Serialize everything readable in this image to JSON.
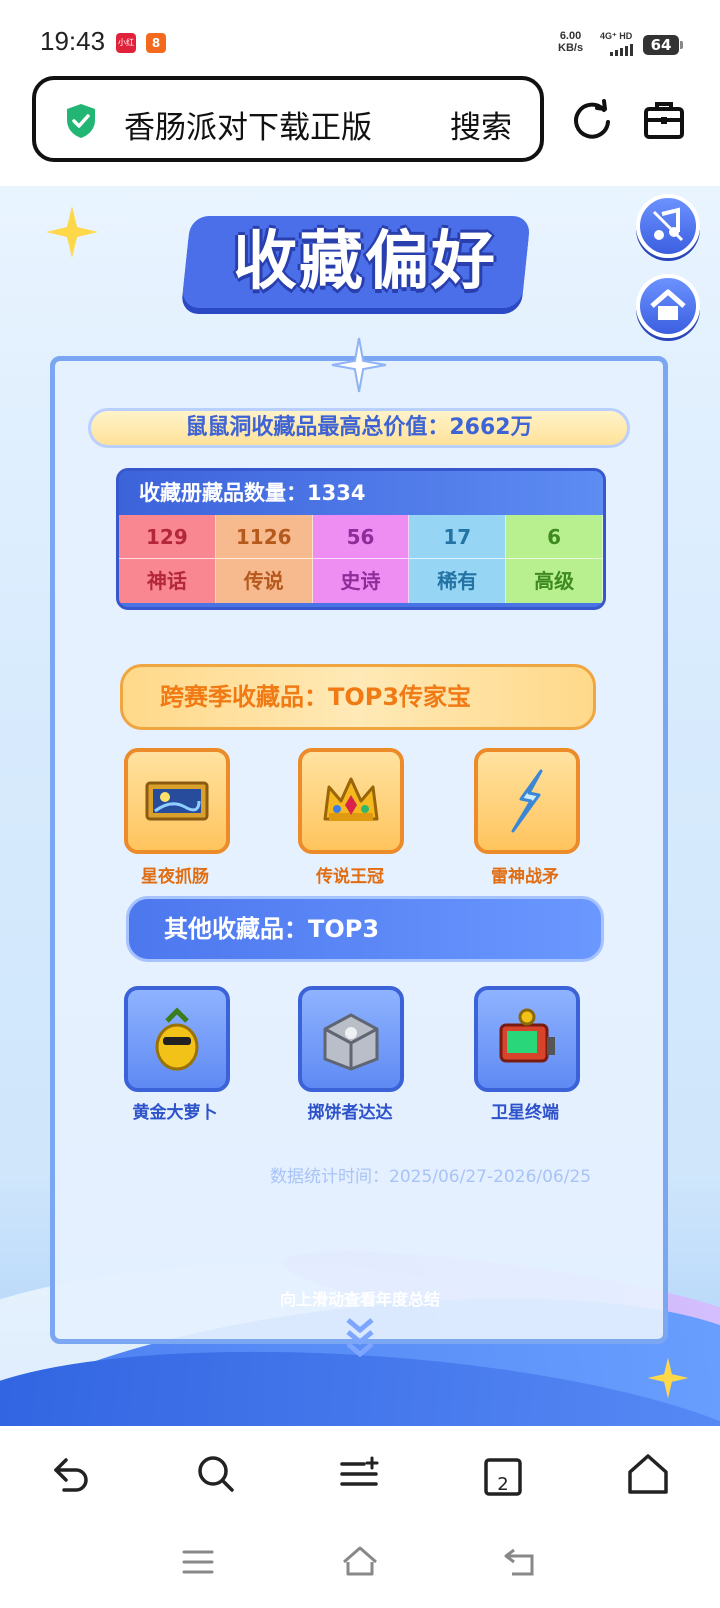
{
  "status_bar": {
    "time": "19:43",
    "app_badge_1": "小红书",
    "app_badge_2": "8",
    "net_speed": "6.00",
    "net_speed_unit": "KB/s",
    "network": "4G⁺ HD",
    "battery": "64"
  },
  "browser": {
    "search_text": "香肠派对下载正版",
    "search_button": "搜索",
    "refresh_icon": "refresh-icon",
    "toolbox_icon": "toolbox-icon",
    "shield_color": "#22b573"
  },
  "page": {
    "title": "收藏偏好",
    "max_value_label": "鼠鼠洞收藏品最高总价值：2662万",
    "collection_count_label": "收藏册藏品数量：",
    "collection_count": "1334",
    "tiers": [
      {
        "count": "129",
        "name": "神话"
      },
      {
        "count": "1126",
        "name": "传说"
      },
      {
        "count": "56",
        "name": "史诗"
      },
      {
        "count": "17",
        "name": "稀有"
      },
      {
        "count": "6",
        "name": "高级"
      }
    ],
    "section_legacy": "跨赛季收藏品：TOP3传家宝",
    "legacy_items": [
      {
        "name": "星夜抓肠"
      },
      {
        "name": "传说王冠"
      },
      {
        "name": "雷神战矛"
      }
    ],
    "section_other": "其他收藏品：TOP3",
    "other_items": [
      {
        "name": "黄金大萝卜"
      },
      {
        "name": "掷饼者达达"
      },
      {
        "name": "卫星终端"
      }
    ],
    "stat_time": "数据统计时间：2025/06/27-2026/06/25",
    "scroll_hint": "向上滑动查看年度总结"
  },
  "bottom_nav": {
    "tab_count": "2"
  },
  "colors": {
    "accent_blue": "#4a6fe8",
    "gold": "#ffc45d",
    "orange_text": "#e16d12"
  }
}
